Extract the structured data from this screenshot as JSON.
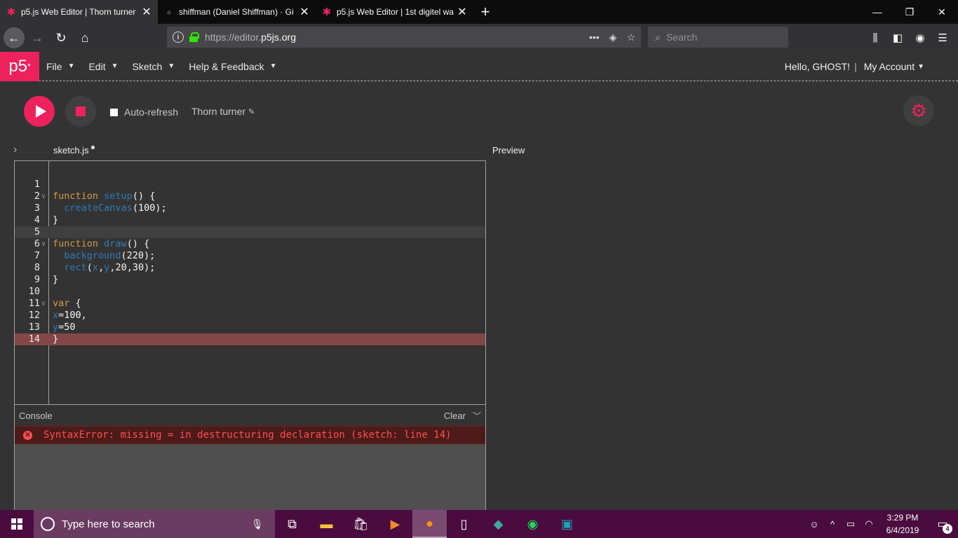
{
  "browser": {
    "tabs": [
      {
        "title": "p5.js Web Editor | Thorn turner",
        "active": true
      },
      {
        "title": "shiffman (Daniel Shiffman) · Gi",
        "active": false
      },
      {
        "title": "p5.js Web Editor | 1st digitel wa",
        "active": false
      }
    ],
    "url_prefix": "https://editor.",
    "url_domain": "p5js.org",
    "search_placeholder": "Search"
  },
  "app": {
    "logo": "p5",
    "logo_sup": "*",
    "menu": [
      {
        "label": "File"
      },
      {
        "label": "Edit"
      },
      {
        "label": "Sketch"
      },
      {
        "label": "Help & Feedback"
      }
    ],
    "greeting": "Hello, GHOST!",
    "separator": "|",
    "account": "My Account"
  },
  "toolbar": {
    "auto_refresh_label": "Auto-refresh",
    "auto_refresh_checked": false,
    "project_name": "Thorn turner"
  },
  "editor": {
    "file_name": "sketch.js",
    "preview_label": "Preview",
    "current_line": 5,
    "error_line": 14,
    "lines": [
      "",
      "function setup() {",
      "  createCanvas(100);",
      "}",
      "",
      "function draw() {",
      "  background(220);",
      "  rect(x,y,20,30);",
      "}",
      "",
      "var {",
      "x=100,",
      "y=50",
      "}"
    ],
    "foldable_lines": [
      2,
      6,
      11
    ]
  },
  "console": {
    "title": "Console",
    "clear_label": "Clear",
    "error_message": "SyntaxError: missing = in destructuring declaration (sketch: line 14)"
  },
  "taskbar": {
    "search_placeholder": "Type here to search",
    "time": "3:29 PM",
    "date": "6/4/2019",
    "notification_count": "4"
  },
  "colors": {
    "accent": "#ed225d",
    "background": "#333333",
    "error_line": "#834747",
    "taskbar": "#4a0b3e"
  }
}
